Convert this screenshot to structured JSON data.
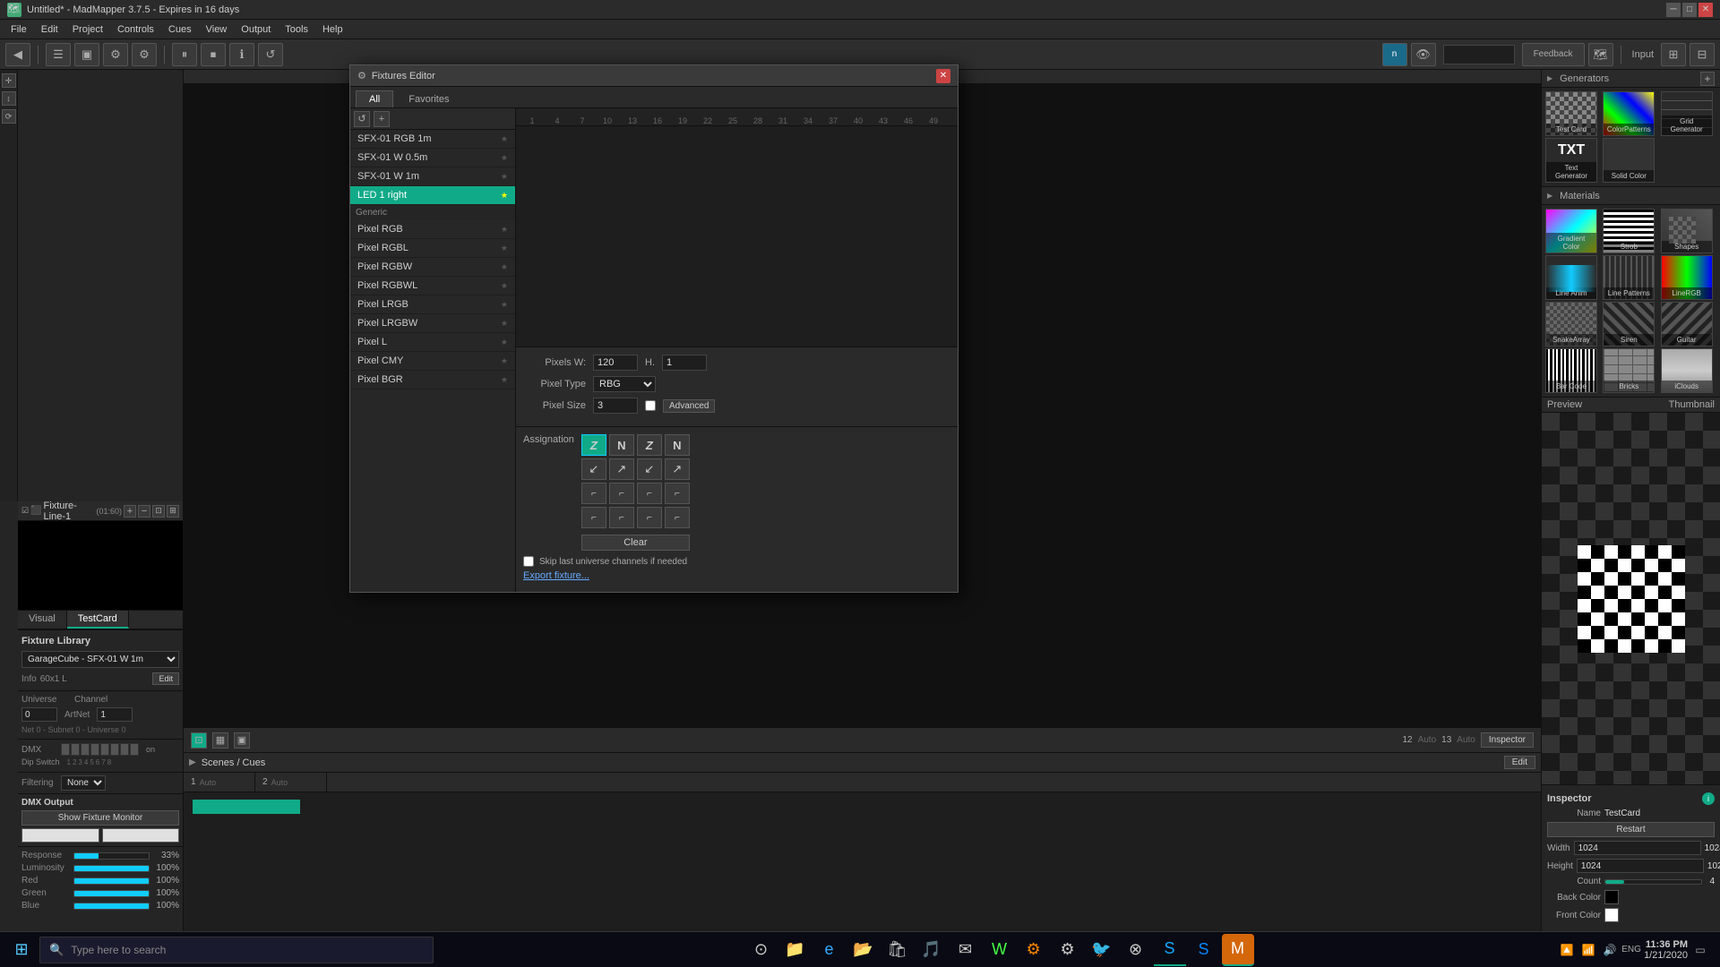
{
  "app": {
    "title": "Untitled* - MadMapper 3.7.5 - Expires in 16 days",
    "icon": "🗺"
  },
  "menu": {
    "items": [
      "File",
      "Edit",
      "Project",
      "Controls",
      "Cues",
      "View",
      "Output",
      "Tools",
      "Help"
    ]
  },
  "toolbar": {
    "buttons": [
      "⏸",
      "⏹",
      "ℹ",
      "↺"
    ]
  },
  "layer_panel": {
    "name": "Fixture-Line-1",
    "range": "(01:60)",
    "add_btn": "+",
    "remove_btn": "−",
    "fit_btn": "⊡",
    "expand_btn": "⊞"
  },
  "preview_tabs": {
    "tabs": [
      "Visual",
      "TestCard"
    ]
  },
  "fixture_library": {
    "title": "Fixture Library",
    "selected": "GarageCube - SFX-01 W 1m",
    "info": "Info",
    "details": "60x1 L",
    "edit_btn": "Edit"
  },
  "universe": {
    "label": "Universe",
    "value": "0",
    "channel_label": "Channel",
    "channel_value": "1",
    "artnet": "ArtNet 0",
    "net_info": "Net 0 - Subnet 0 - Universe 0"
  },
  "dmx": {
    "label": "DMX",
    "on_label": "on",
    "dip_label": "Dip Switch",
    "numbers": [
      "1",
      "2",
      "3",
      "4",
      "5",
      "6",
      "7",
      "8"
    ],
    "switches": [
      false,
      false,
      false,
      false,
      false,
      false,
      false,
      false
    ]
  },
  "filtering": {
    "label": "Filtering",
    "value": "None"
  },
  "dmx_output": {
    "title": "DMX Output",
    "show_fixture_btn": "Show Fixture Monitor"
  },
  "sliders": {
    "response": {
      "label": "Response",
      "value": 33,
      "pct": "33%"
    },
    "luminosity": {
      "label": "Luminosity",
      "value": 100,
      "pct": "100%"
    },
    "red": {
      "label": "Red",
      "value": 100,
      "pct": "100%"
    },
    "green": {
      "label": "Green",
      "value": 100,
      "pct": "100%"
    },
    "blue": {
      "label": "Blue",
      "value": 100,
      "pct": "100%"
    }
  },
  "generators": {
    "section_title": "Generators",
    "items": [
      {
        "name": "Test Card",
        "type": "testcard"
      },
      {
        "name": "ColorPatterns",
        "type": "colorpattern"
      },
      {
        "name": "Grid Generator",
        "type": "grid"
      },
      {
        "name": "TXT\nText Generator",
        "type": "text"
      },
      {
        "name": "Solid Color",
        "type": "solid"
      }
    ]
  },
  "materials": {
    "section_title": "Materials",
    "items": [
      {
        "name": "Gradient Color",
        "type": "gradient"
      },
      {
        "name": "Strob",
        "type": "strob"
      },
      {
        "name": "Shapes",
        "type": "shapes"
      },
      {
        "name": "Line Anim",
        "type": "lineanim"
      },
      {
        "name": "Line Patterns",
        "type": "linepatterns"
      },
      {
        "name": "LineRGB",
        "type": "linergb"
      },
      {
        "name": "SnakeArray",
        "type": "snakearray"
      },
      {
        "name": "Siren",
        "type": "siren"
      },
      {
        "name": "Guitar",
        "type": "guitar"
      },
      {
        "name": "Bar Code",
        "type": "barcode"
      },
      {
        "name": "Bricks",
        "type": "bricks"
      },
      {
        "name": "iClouds",
        "type": "iclouds"
      }
    ]
  },
  "right_panel": {
    "input_label": "Input",
    "preview_label": "Preview",
    "thumbnail_label": "Thumbnail"
  },
  "inspector": {
    "title": "Inspector",
    "name_label": "Name",
    "name_value": "TestCard",
    "restart_btn": "Restart",
    "width_label": "Width",
    "width_value": "1024",
    "height_label": "Height",
    "height_value": "1024",
    "count_label": "Count",
    "count_value": "4",
    "back_color_label": "Back Color",
    "front_color_label": "Front Color"
  },
  "fixtures_editor": {
    "title": "Fixtures Editor",
    "tabs": [
      "All",
      "Favorites"
    ],
    "close_btn": "×",
    "list_items": [
      {
        "name": "SFX-01 RGB 1m",
        "selected": false
      },
      {
        "name": "SFX-01 W 0.5m",
        "selected": false
      },
      {
        "name": "SFX-01 W 1m",
        "selected": false
      },
      {
        "name": "LED 1 right",
        "selected": true
      }
    ],
    "generic_category": "Generic",
    "generic_items": [
      {
        "name": "Pixel RGB"
      },
      {
        "name": "Pixel RGBL"
      },
      {
        "name": "Pixel RGBW"
      },
      {
        "name": "Pixel RGBWL"
      },
      {
        "name": "Pixel LRGB"
      },
      {
        "name": "Pixel LRGBW"
      },
      {
        "name": "Pixel L"
      },
      {
        "name": "Pixel CMY"
      },
      {
        "name": "Pixel BGR"
      }
    ],
    "pixels_w_label": "Pixels W:",
    "pixels_w_value": "120",
    "pixels_h_label": "H.",
    "pixels_h_value": "1",
    "pixel_type_label": "Pixel Type",
    "pixel_type_value": "RBG",
    "pixel_size_label": "Pixel Size",
    "pixel_size_value": "3",
    "advanced_btn": "Advanced",
    "assignation_label": "Assignation",
    "assign_patterns": [
      "Z",
      "N",
      "Z",
      "N",
      "↙",
      "↗",
      "↙",
      "↗",
      "⌐",
      "⌐",
      "⌐",
      "⌐",
      "⌐",
      "⌐",
      "⌐",
      "⌐"
    ],
    "clear_btn": "Clear",
    "skip_checkbox_label": "Skip last universe channels if needed",
    "export_btn": "Export fixture...",
    "ruler_marks": [
      "1",
      "4",
      "7",
      "10",
      "13",
      "16",
      "19",
      "22",
      "25",
      "28",
      "31",
      "34",
      "37",
      "40",
      "43",
      "46",
      "49"
    ]
  },
  "scenes": {
    "title": "Scenes / Cues",
    "edit_btn": "Edit",
    "cues": [
      {
        "number": "1",
        "mode": "Auto"
      },
      {
        "number": "2",
        "mode": "Auto"
      },
      {
        "number": "12",
        "mode": "Auto"
      },
      {
        "number": "13",
        "mode": "Auto"
      }
    ]
  },
  "taskbar": {
    "search_placeholder": "Type here to search",
    "time": "11:36 PM",
    "date": "1/21/2020",
    "lang": "ENG"
  }
}
